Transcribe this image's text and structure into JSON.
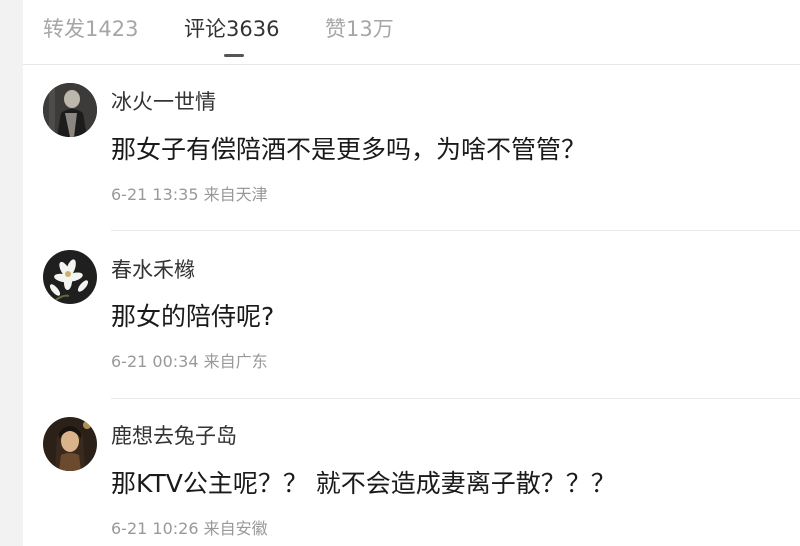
{
  "tabs": [
    {
      "label": "转发1423",
      "active": false
    },
    {
      "label": "评论3636",
      "active": true
    },
    {
      "label": "赞13万",
      "active": false
    }
  ],
  "comments": [
    {
      "username": "冰火一世情",
      "content": "那女子有偿陪酒不是更多吗，为啥不管管？",
      "time": "6-21 13:35",
      "source": "来自天津",
      "avatar_icon": "user-avatar-dark-figure"
    },
    {
      "username": "春水禾橼",
      "content": "那女的陪侍呢?",
      "time": "6-21 00:34",
      "source": "来自广东",
      "avatar_icon": "user-avatar-white-flowers"
    },
    {
      "username": "鹿想去兔子岛",
      "content": "那KTV公主呢？？ 就不会造成妻离子散？？？",
      "time": "6-21 10:26",
      "source": "来自安徽",
      "avatar_icon": "user-avatar-portrait"
    }
  ]
}
